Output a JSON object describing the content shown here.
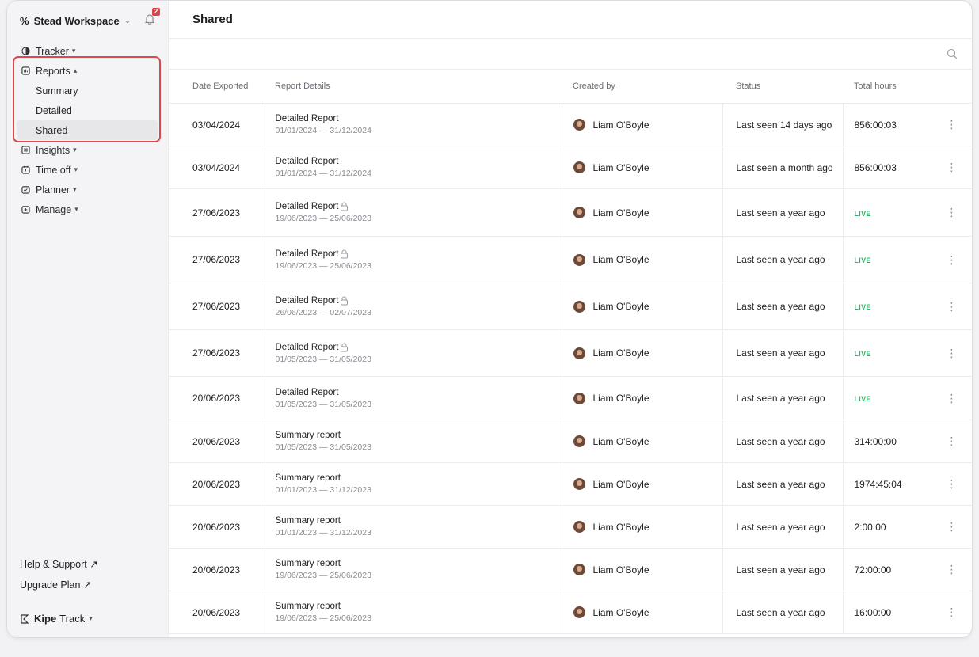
{
  "sidebar": {
    "workspace_name": "Stead Workspace",
    "notification_count": "2",
    "nav": [
      {
        "label": "Tracker",
        "icon": "tracker-icon",
        "expanded": false
      },
      {
        "label": "Reports",
        "icon": "reports-icon",
        "expanded": true,
        "children": [
          {
            "label": "Summary",
            "active": false
          },
          {
            "label": "Detailed",
            "active": false
          },
          {
            "label": "Shared",
            "active": true
          }
        ]
      },
      {
        "label": "Insights",
        "icon": "insights-icon",
        "expanded": false
      },
      {
        "label": "Time off",
        "icon": "time-off-icon",
        "expanded": false
      },
      {
        "label": "Planner",
        "icon": "planner-icon",
        "expanded": false
      },
      {
        "label": "Manage",
        "icon": "manage-icon",
        "expanded": false
      }
    ],
    "help_label": "Help & Support ↗",
    "upgrade_label": "Upgrade Plan ↗",
    "brand_bold": "Kipe",
    "brand_rest": "Track"
  },
  "main": {
    "title": "Shared",
    "table": {
      "headers": [
        "Date Exported",
        "Report Details",
        "Created by",
        "Status",
        "Total hours"
      ],
      "rows": [
        {
          "date": "03/04/2024",
          "name": "Detailed Report",
          "range": "01/01/2024 — 31/12/2024",
          "locked": false,
          "creator": "Liam O'Boyle",
          "status": "Last seen 14 days ago",
          "hours": "856:00:03",
          "live": false
        },
        {
          "date": "03/04/2024",
          "name": "Detailed Report",
          "range": "01/01/2024 — 31/12/2024",
          "locked": false,
          "creator": "Liam O'Boyle",
          "status": "Last seen a month ago",
          "hours": "856:00:03",
          "live": false
        },
        {
          "date": "27/06/2023",
          "name": "Detailed Report",
          "range": "19/06/2023 — 25/06/2023",
          "locked": true,
          "creator": "Liam O'Boyle",
          "status": "Last seen a year ago",
          "hours": "LIVE",
          "live": true
        },
        {
          "date": "27/06/2023",
          "name": "Detailed Report",
          "range": "19/06/2023 — 25/06/2023",
          "locked": true,
          "creator": "Liam O'Boyle",
          "status": "Last seen a year ago",
          "hours": "LIVE",
          "live": true
        },
        {
          "date": "27/06/2023",
          "name": "Detailed Report",
          "range": "26/06/2023 — 02/07/2023",
          "locked": true,
          "creator": "Liam O'Boyle",
          "status": "Last seen a year ago",
          "hours": "LIVE",
          "live": true
        },
        {
          "date": "27/06/2023",
          "name": "Detailed Report",
          "range": "01/05/2023 — 31/05/2023",
          "locked": true,
          "creator": "Liam O'Boyle",
          "status": "Last seen a year ago",
          "hours": "LIVE",
          "live": true
        },
        {
          "date": "20/06/2023",
          "name": "Detailed Report",
          "range": "01/05/2023 — 31/05/2023",
          "locked": false,
          "creator": "Liam O'Boyle",
          "status": "Last seen a year ago",
          "hours": "LIVE",
          "live": true
        },
        {
          "date": "20/06/2023",
          "name": "Summary report",
          "range": "01/05/2023 — 31/05/2023",
          "locked": false,
          "creator": "Liam O'Boyle",
          "status": "Last seen a year ago",
          "hours": "314:00:00",
          "live": false
        },
        {
          "date": "20/06/2023",
          "name": "Summary report",
          "range": "01/01/2023 — 31/12/2023",
          "locked": false,
          "creator": "Liam O'Boyle",
          "status": "Last seen a year ago",
          "hours": "1974:45:04",
          "live": false
        },
        {
          "date": "20/06/2023",
          "name": "Summary report",
          "range": "01/01/2023 — 31/12/2023",
          "locked": false,
          "creator": "Liam O'Boyle",
          "status": "Last seen a year ago",
          "hours": "2:00:00",
          "live": false
        },
        {
          "date": "20/06/2023",
          "name": "Summary report",
          "range": "19/06/2023 — 25/06/2023",
          "locked": false,
          "creator": "Liam O'Boyle",
          "status": "Last seen a year ago",
          "hours": "72:00:00",
          "live": false
        },
        {
          "date": "20/06/2023",
          "name": "Summary report",
          "range": "19/06/2023 — 25/06/2023",
          "locked": false,
          "creator": "Liam O'Boyle",
          "status": "Last seen a year ago",
          "hours": "16:00:00",
          "live": false
        }
      ]
    }
  },
  "colors": {
    "accent_red": "#e0464d",
    "live_green": "#34b36b"
  }
}
